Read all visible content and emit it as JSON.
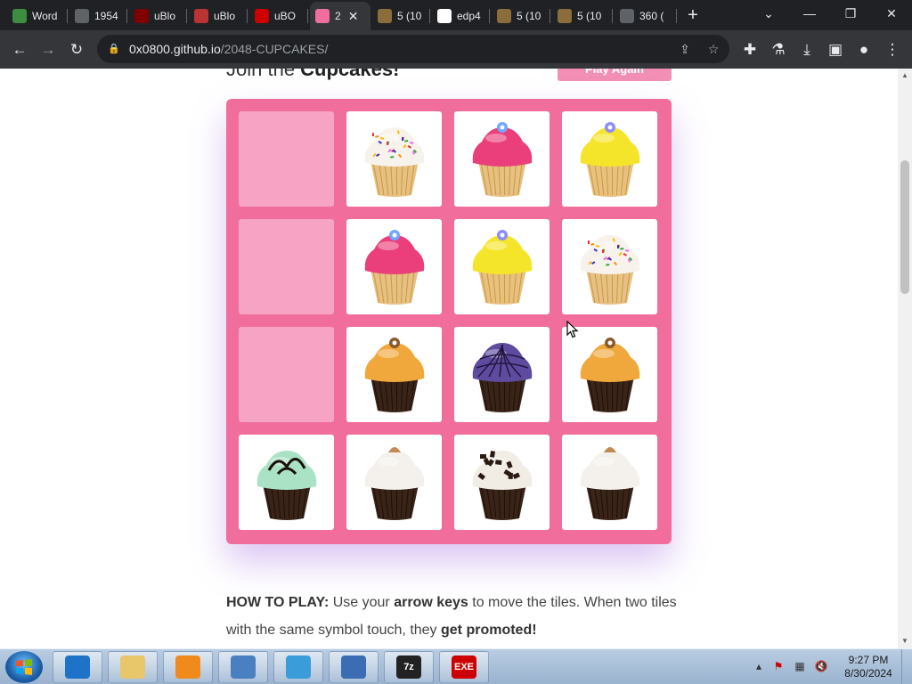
{
  "browser": {
    "tabs": [
      {
        "label": "Word",
        "icon": "w-icon",
        "color": "#3d8c40"
      },
      {
        "label": "1954",
        "icon": "globe-icon",
        "color": "#5f6368"
      },
      {
        "label": "uBlo",
        "icon": "ublock-icon",
        "color": "#800000"
      },
      {
        "label": "uBlo",
        "icon": "image-icon",
        "color": "#b33"
      },
      {
        "label": "uBO",
        "icon": "ublock-icon",
        "color": "#c00"
      },
      {
        "label": "2",
        "icon": "cupcake-icon",
        "color": "#f06d9c"
      },
      {
        "label": "5 (10",
        "icon": "folder-icon",
        "color": "#8a6d3b"
      },
      {
        "label": "edp4",
        "icon": "google-icon",
        "color": "#fff"
      },
      {
        "label": "5 (10",
        "icon": "folder-icon",
        "color": "#8a6d3b"
      },
      {
        "label": "5 (10",
        "icon": "folder-icon",
        "color": "#8a6d3b"
      },
      {
        "label": "360 (",
        "icon": "globe-icon",
        "color": "#5f6368"
      }
    ],
    "url_host": "0x0800.github.io",
    "url_path": "/2048-CUPCAKES/"
  },
  "page": {
    "heading_prefix": "Join the ",
    "heading_bold": "Cupcakes!",
    "play_again": "Play Again",
    "howto_label": "HOW TO PLAY:",
    "howto_text1": " Use your ",
    "howto_bold1": "arrow keys",
    "howto_text2": " to move the tiles. When two tiles with the same symbol touch, they ",
    "howto_bold2": "get promoted!"
  },
  "board": {
    "accent": "#f06d9c",
    "rows": [
      [
        "empty",
        "sprinkle-white",
        "pink-frosting",
        "yellow-frosting"
      ],
      [
        "empty",
        "pink-frosting",
        "yellow-frosting",
        "sprinkle-white"
      ],
      [
        "empty",
        "orange-chocolate",
        "purple-web",
        "orange-chocolate"
      ],
      [
        "mint-chocolate",
        "vanilla-chocolate",
        "cookies-cream",
        "vanilla-chocolate"
      ]
    ]
  },
  "taskbar": {
    "apps": [
      {
        "name": "ie-icon",
        "label": ""
      },
      {
        "name": "explorer-icon",
        "label": ""
      },
      {
        "name": "media-player-icon",
        "label": ""
      },
      {
        "name": "control-panel-icon",
        "label": ""
      },
      {
        "name": "chrome-icon",
        "label": ""
      },
      {
        "name": "document-icon",
        "label": ""
      },
      {
        "name": "7zip-icon",
        "label": "7z"
      },
      {
        "name": "youtube-exe-icon",
        "label": "EXE"
      }
    ],
    "time": "9:27 PM",
    "date": "8/30/2024"
  }
}
